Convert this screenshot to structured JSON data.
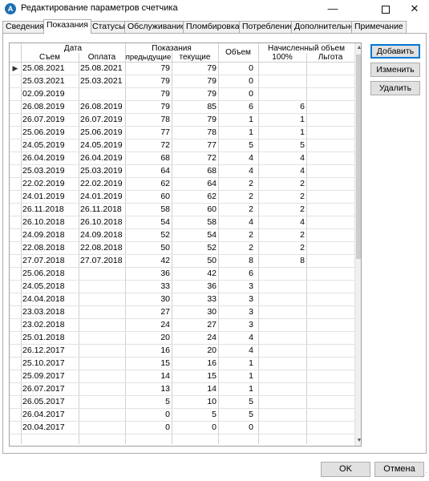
{
  "window": {
    "title": "Редактирование параметров счетчика",
    "app_icon": "А",
    "minimize_glyph": "—",
    "close_glyph": "✕"
  },
  "tabs": [
    {
      "label": "Сведения",
      "active": false
    },
    {
      "label": "Показания",
      "active": true
    },
    {
      "label": "Статусы",
      "active": false
    },
    {
      "label": "Обслуживание",
      "active": false
    },
    {
      "label": "Пломбировка",
      "active": false
    },
    {
      "label": "Потребление",
      "active": false
    },
    {
      "label": "Дополнительно",
      "active": false
    },
    {
      "label": "Примечание",
      "active": false
    }
  ],
  "grid": {
    "headers": {
      "group_date": "Дата",
      "date_read": "Съем",
      "date_pay": "Оплата",
      "group_readings": "Показания",
      "prev": "предыдущие",
      "cur": "текущие",
      "volume": "Объем",
      "group_charged": "Начисленный объем",
      "pct100": "100%",
      "benefit": "Льгота"
    },
    "current_row_glyph": "▶",
    "rows": [
      {
        "read": "25.08.2021",
        "pay": "25.08.2021",
        "prev": "79",
        "cur": "79",
        "vol": "0",
        "p100": "",
        "lg": ""
      },
      {
        "read": "25.03.2021",
        "pay": "25.03.2021",
        "prev": "79",
        "cur": "79",
        "vol": "0",
        "p100": "",
        "lg": ""
      },
      {
        "read": "02.09.2019",
        "pay": "",
        "prev": "79",
        "cur": "79",
        "vol": "0",
        "p100": "",
        "lg": ""
      },
      {
        "read": "26.08.2019",
        "pay": "26.08.2019",
        "prev": "79",
        "cur": "85",
        "vol": "6",
        "p100": "6",
        "lg": ""
      },
      {
        "read": "26.07.2019",
        "pay": "26.07.2019",
        "prev": "78",
        "cur": "79",
        "vol": "1",
        "p100": "1",
        "lg": ""
      },
      {
        "read": "25.06.2019",
        "pay": "25.06.2019",
        "prev": "77",
        "cur": "78",
        "vol": "1",
        "p100": "1",
        "lg": ""
      },
      {
        "read": "24.05.2019",
        "pay": "24.05.2019",
        "prev": "72",
        "cur": "77",
        "vol": "5",
        "p100": "5",
        "lg": ""
      },
      {
        "read": "26.04.2019",
        "pay": "26.04.2019",
        "prev": "68",
        "cur": "72",
        "vol": "4",
        "p100": "4",
        "lg": ""
      },
      {
        "read": "25.03.2019",
        "pay": "25.03.2019",
        "prev": "64",
        "cur": "68",
        "vol": "4",
        "p100": "4",
        "lg": ""
      },
      {
        "read": "22.02.2019",
        "pay": "22.02.2019",
        "prev": "62",
        "cur": "64",
        "vol": "2",
        "p100": "2",
        "lg": ""
      },
      {
        "read": "24.01.2019",
        "pay": "24.01.2019",
        "prev": "60",
        "cur": "62",
        "vol": "2",
        "p100": "2",
        "lg": ""
      },
      {
        "read": "26.11.2018",
        "pay": "26.11.2018",
        "prev": "58",
        "cur": "60",
        "vol": "2",
        "p100": "2",
        "lg": ""
      },
      {
        "read": "26.10.2018",
        "pay": "26.10.2018",
        "prev": "54",
        "cur": "58",
        "vol": "4",
        "p100": "4",
        "lg": ""
      },
      {
        "read": "24.09.2018",
        "pay": "24.09.2018",
        "prev": "52",
        "cur": "54",
        "vol": "2",
        "p100": "2",
        "lg": ""
      },
      {
        "read": "22.08.2018",
        "pay": "22.08.2018",
        "prev": "50",
        "cur": "52",
        "vol": "2",
        "p100": "2",
        "lg": ""
      },
      {
        "read": "27.07.2018",
        "pay": "27.07.2018",
        "prev": "42",
        "cur": "50",
        "vol": "8",
        "p100": "8",
        "lg": ""
      },
      {
        "read": "25.06.2018",
        "pay": "",
        "prev": "36",
        "cur": "42",
        "vol": "6",
        "p100": "",
        "lg": ""
      },
      {
        "read": "24.05.2018",
        "pay": "",
        "prev": "33",
        "cur": "36",
        "vol": "3",
        "p100": "",
        "lg": ""
      },
      {
        "read": "24.04.2018",
        "pay": "",
        "prev": "30",
        "cur": "33",
        "vol": "3",
        "p100": "",
        "lg": ""
      },
      {
        "read": "23.03.2018",
        "pay": "",
        "prev": "27",
        "cur": "30",
        "vol": "3",
        "p100": "",
        "lg": ""
      },
      {
        "read": "23.02.2018",
        "pay": "",
        "prev": "24",
        "cur": "27",
        "vol": "3",
        "p100": "",
        "lg": ""
      },
      {
        "read": "25.01.2018",
        "pay": "",
        "prev": "20",
        "cur": "24",
        "vol": "4",
        "p100": "",
        "lg": ""
      },
      {
        "read": "26.12.2017",
        "pay": "",
        "prev": "16",
        "cur": "20",
        "vol": "4",
        "p100": "",
        "lg": ""
      },
      {
        "read": "25.10.2017",
        "pay": "",
        "prev": "15",
        "cur": "16",
        "vol": "1",
        "p100": "",
        "lg": ""
      },
      {
        "read": "25.09.2017",
        "pay": "",
        "prev": "14",
        "cur": "15",
        "vol": "1",
        "p100": "",
        "lg": ""
      },
      {
        "read": "26.07.2017",
        "pay": "",
        "prev": "13",
        "cur": "14",
        "vol": "1",
        "p100": "",
        "lg": ""
      },
      {
        "read": "26.05.2017",
        "pay": "",
        "prev": "5",
        "cur": "10",
        "vol": "5",
        "p100": "",
        "lg": ""
      },
      {
        "read": "26.04.2017",
        "pay": "",
        "prev": "0",
        "cur": "5",
        "vol": "5",
        "p100": "",
        "lg": ""
      },
      {
        "read": "20.04.2017",
        "pay": "",
        "prev": "0",
        "cur": "0",
        "vol": "0",
        "p100": "",
        "lg": ""
      }
    ]
  },
  "side_buttons": {
    "add": "Добавить",
    "edit": "Изменить",
    "delete": "Удалить"
  },
  "footer": {
    "ok": "OK",
    "cancel": "Отмена"
  }
}
